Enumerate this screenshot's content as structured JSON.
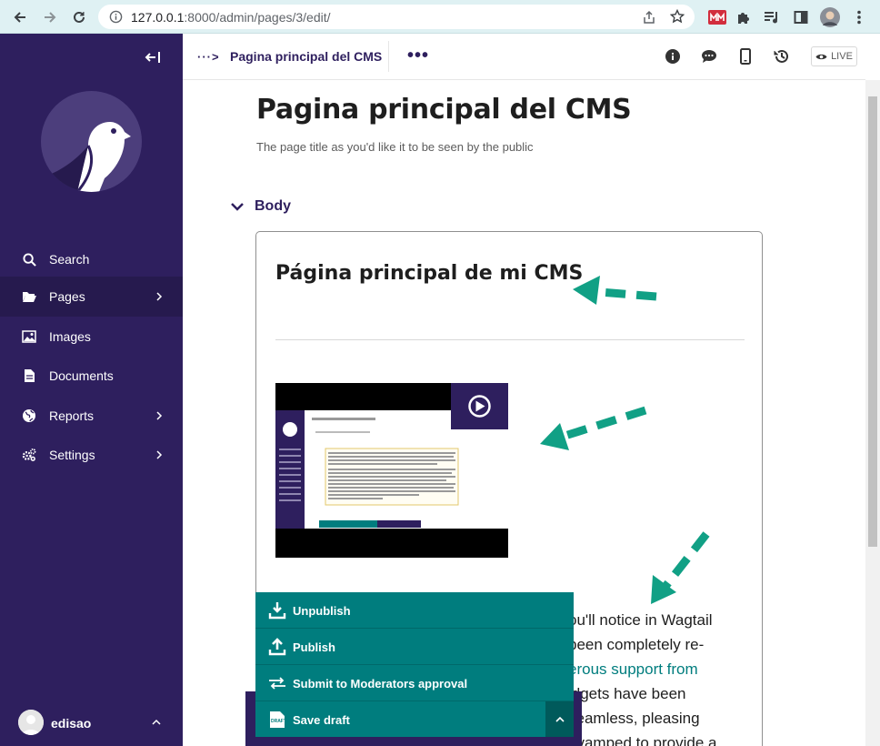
{
  "browser": {
    "url_host": "127.0.0.1",
    "url_rest": ":8000/admin/pages/3/edit/"
  },
  "sidebar": {
    "items": [
      {
        "label": "Search",
        "icon": "search-icon"
      },
      {
        "label": "Pages",
        "icon": "folder-open-icon",
        "active": true
      },
      {
        "label": "Images",
        "icon": "image-icon"
      },
      {
        "label": "Documents",
        "icon": "document-icon"
      },
      {
        "label": "Reports",
        "icon": "globe-icon"
      },
      {
        "label": "Settings",
        "icon": "cogs-icon"
      }
    ],
    "user": {
      "name": "edisao"
    }
  },
  "header": {
    "breadcrumb_dots": "···>",
    "title": "Pagina principal del CMS",
    "more": "•••",
    "live_label": "LIVE"
  },
  "main": {
    "page_title": "Pagina principal del CMS",
    "title_help": "The page title as you'd like it to be seen by the public",
    "body_label": "Body",
    "editor": {
      "heading": "Página principal de mi CMS",
      "paragraph": {
        "line1": "ou'll notice in Wagtail",
        "line2": "been completely re-",
        "line3_link": "erous support from",
        "line4": "idgets have been",
        "line5": "seamless, pleasing",
        "line6": "evamped to provide a"
      }
    }
  },
  "actions": {
    "unpublish": "Unpublish",
    "publish": "Publish",
    "submit": "Submit to Moderators approval",
    "save_draft": "Save draft"
  },
  "colors": {
    "sidebar": "#2e1f5e",
    "accent": "#007d7e",
    "arrow": "#11a085"
  }
}
